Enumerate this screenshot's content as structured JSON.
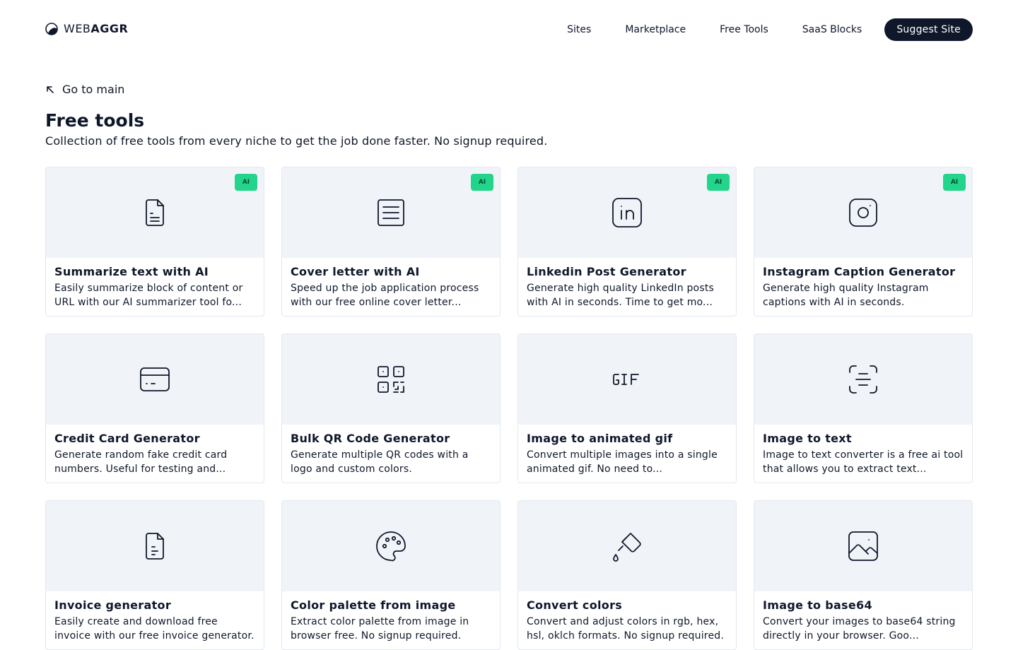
{
  "header": {
    "logo_light": "WEB",
    "logo_bold": "AGGR",
    "nav": [
      {
        "label": "Sites"
      },
      {
        "label": "Marketplace"
      },
      {
        "label": "Free Tools"
      },
      {
        "label": "SaaS Blocks"
      }
    ],
    "cta": "Suggest Site"
  },
  "back": {
    "label": "Go to main",
    "icon": "arrow-up-left-icon"
  },
  "page": {
    "title": "Free tools",
    "subtitle": "Collection of free tools from every niche to get the job done faster. No signup required."
  },
  "colors": {
    "accent_badge": "#22d58a",
    "card_top": "#f0f4f9",
    "dark": "#0f172a",
    "border": "#e2e8f0"
  },
  "tools": [
    {
      "title": "Summarize text with AI",
      "desc": "Easily summarize block of content or URL with our AI summarizer tool fo...",
      "badge": "AI",
      "icon": "document-text-icon"
    },
    {
      "title": "Cover letter with AI",
      "desc": "Speed up the job application process with our free online cover letter...",
      "badge": "AI",
      "icon": "lines-box-icon"
    },
    {
      "title": "Linkedin Post Generator",
      "desc": "Generate high quality LinkedIn posts with AI in seconds. Time to get mo...",
      "badge": "AI",
      "icon": "linkedin-icon"
    },
    {
      "title": "Instagram Caption Generator",
      "desc": "Generate high quality Instagram captions with AI in seconds.",
      "badge": "AI",
      "icon": "instagram-icon"
    },
    {
      "title": "Credit Card Generator",
      "desc": "Generate random fake credit card numbers. Useful for testing and...",
      "badge": "",
      "icon": "credit-card-icon"
    },
    {
      "title": "Bulk QR Code Generator",
      "desc": "Generate multiple QR codes with a logo and custom colors.",
      "badge": "",
      "icon": "qr-code-icon"
    },
    {
      "title": "Image to animated gif",
      "desc": "Convert multiple images into a single animated gif. No need to...",
      "badge": "",
      "icon": "gif-icon"
    },
    {
      "title": "Image to text",
      "desc": "Image to text converter is a free ai tool that allows you to extract text...",
      "badge": "",
      "icon": "text-scan-icon"
    },
    {
      "title": "Invoice generator",
      "desc": "Easily create and download free invoice with our free invoice generator.",
      "badge": "",
      "icon": "invoice-icon"
    },
    {
      "title": "Color palette from image",
      "desc": "Extract color palette from image in browser free. No signup required.",
      "badge": "",
      "icon": "palette-icon"
    },
    {
      "title": "Convert colors",
      "desc": "Convert and adjust colors in rgb, hex, hsl, oklch formats. No signup required.",
      "badge": "",
      "icon": "paint-bucket-icon"
    },
    {
      "title": "Image to base64",
      "desc": "Convert your images to base64 string directly in your browser. Goo...",
      "badge": "",
      "icon": "image-icon"
    }
  ]
}
